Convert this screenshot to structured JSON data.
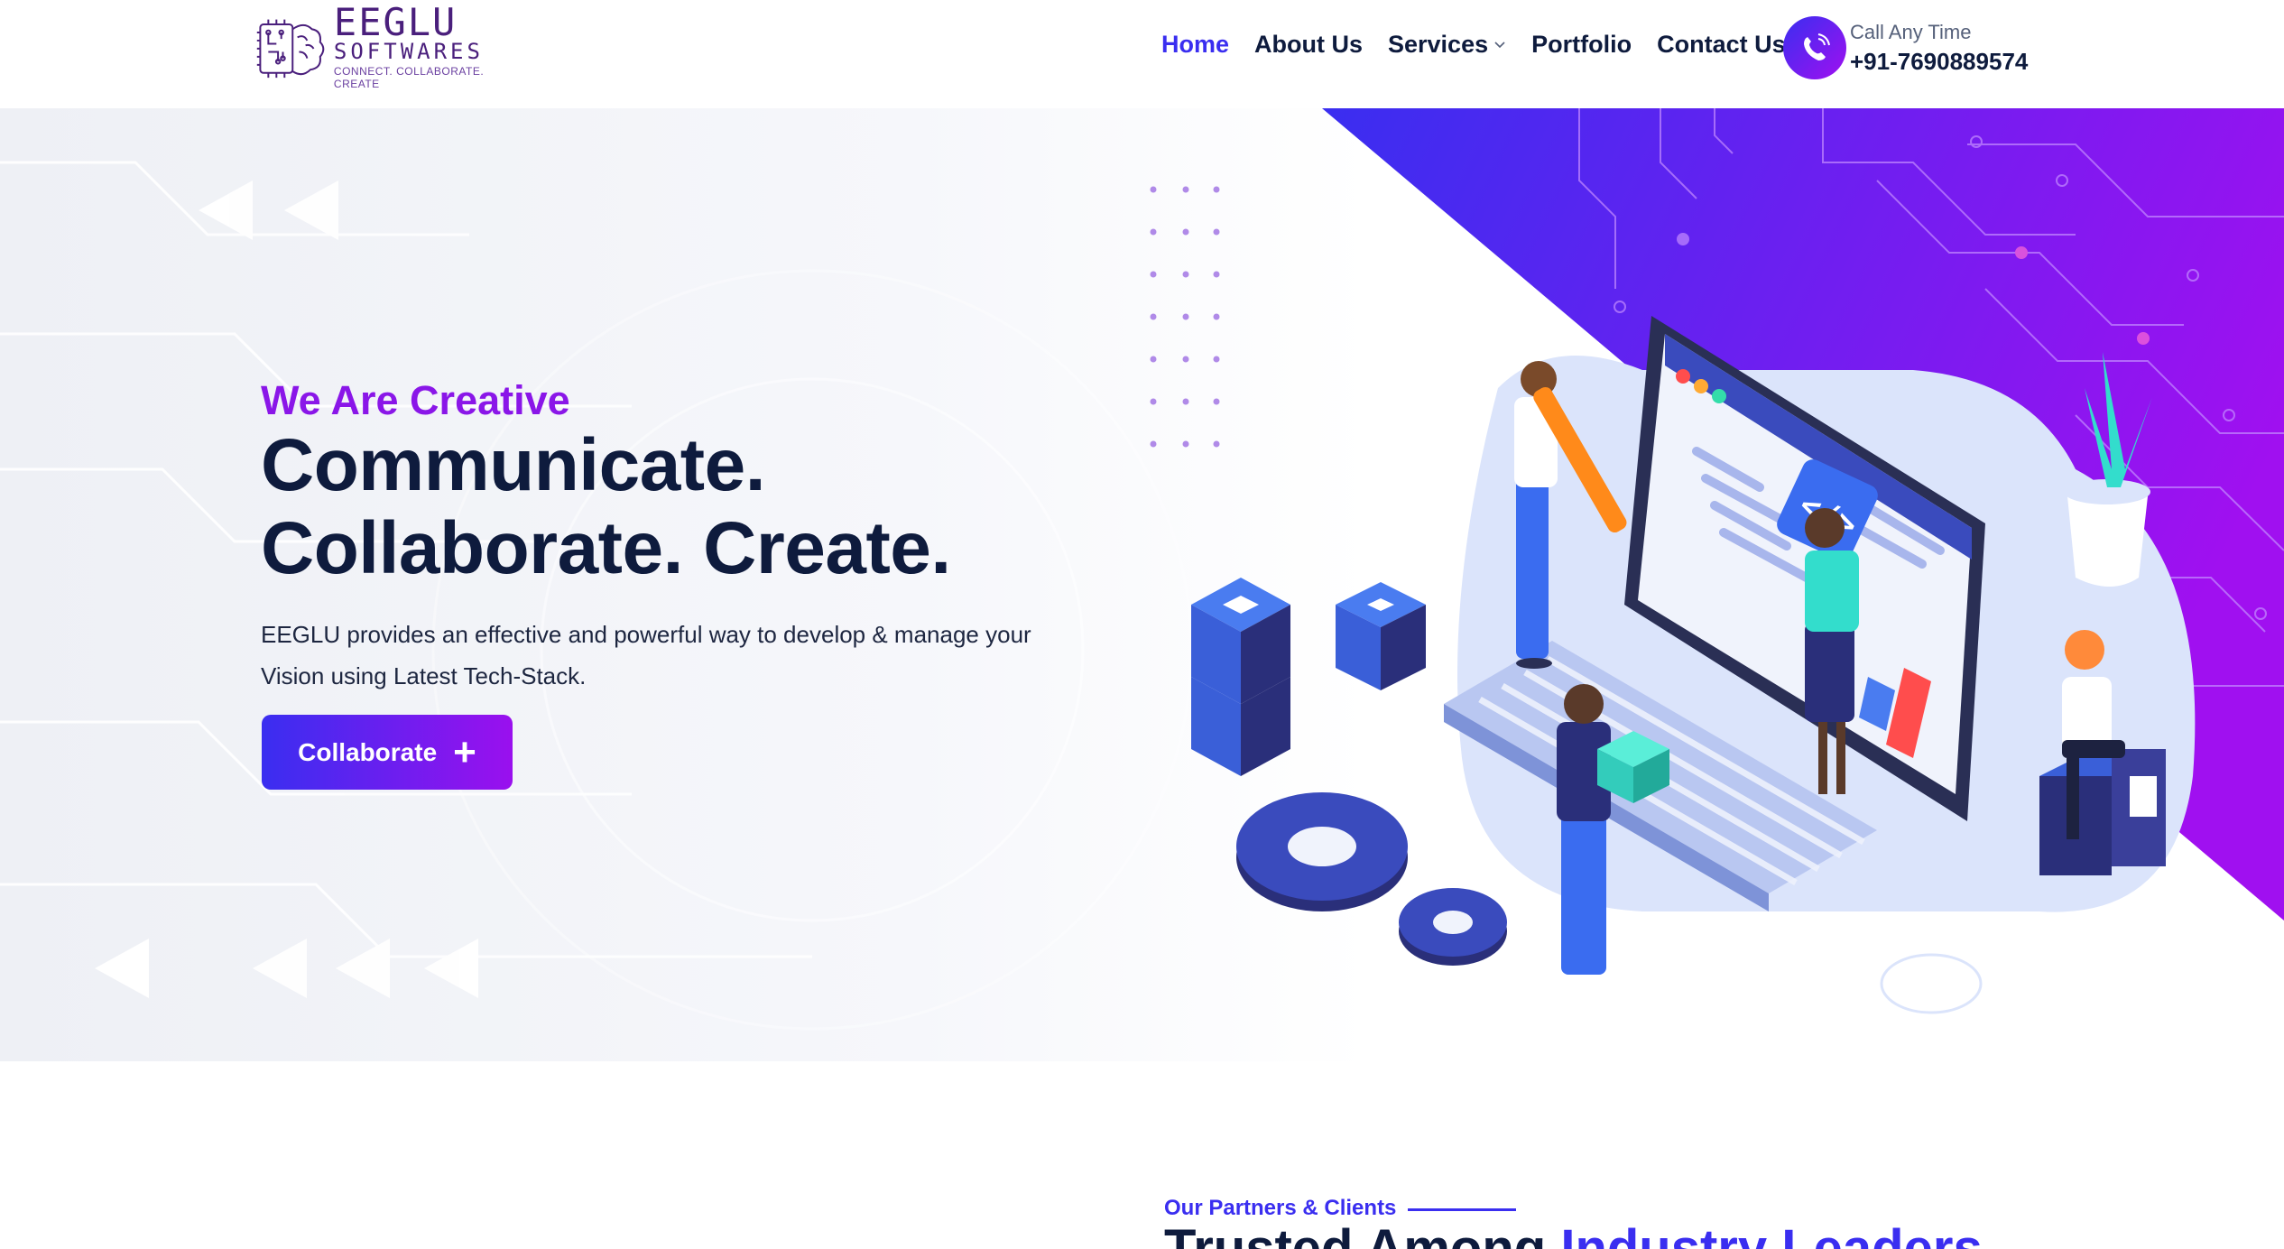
{
  "brand": {
    "name": "EEGLU",
    "sub": "SOFTWARES",
    "tagline": "CONNECT. COLLABORATE. CREATE"
  },
  "nav": {
    "items": [
      {
        "label": "Home"
      },
      {
        "label": "About Us"
      },
      {
        "label": "Services"
      },
      {
        "label": "Portfolio"
      },
      {
        "label": "Contact Us"
      }
    ]
  },
  "call": {
    "label": "Call Any Time",
    "number": "+91-7690889574"
  },
  "hero": {
    "eyebrow": "We Are Creative",
    "line1": "Communicate.",
    "line2": "Collaborate. Create.",
    "description": "EEGLU provides an effective and powerful way to develop & manage your Vision using Latest Tech-Stack.",
    "cta_label": "Collaborate",
    "cta_icon": "+"
  },
  "partners": {
    "label": "Our Partners & Clients",
    "heading_plain": "Trusted Among",
    "heading_highlight": "Industry Leaders"
  },
  "colors": {
    "accent": "#3a2ef0",
    "purple": "#8a16e8",
    "dark": "#0e1b3d"
  }
}
